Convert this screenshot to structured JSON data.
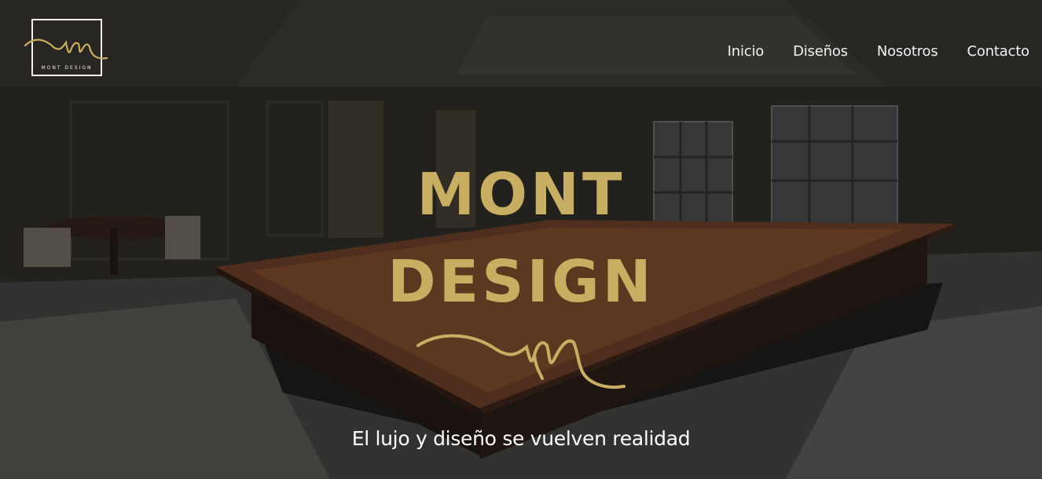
{
  "brand": {
    "logo_text": "MONT DESIGN",
    "accent_color": "#c7ae62"
  },
  "nav": {
    "items": [
      {
        "label": "Inicio"
      },
      {
        "label": "Diseños"
      },
      {
        "label": "Nosotros"
      },
      {
        "label": "Contacto"
      }
    ]
  },
  "hero": {
    "title_line1": "MONT",
    "title_line2": "DESIGN",
    "tagline": "El lujo y diseño se vuelven realidad",
    "background": "dark conference room with large wooden table"
  }
}
